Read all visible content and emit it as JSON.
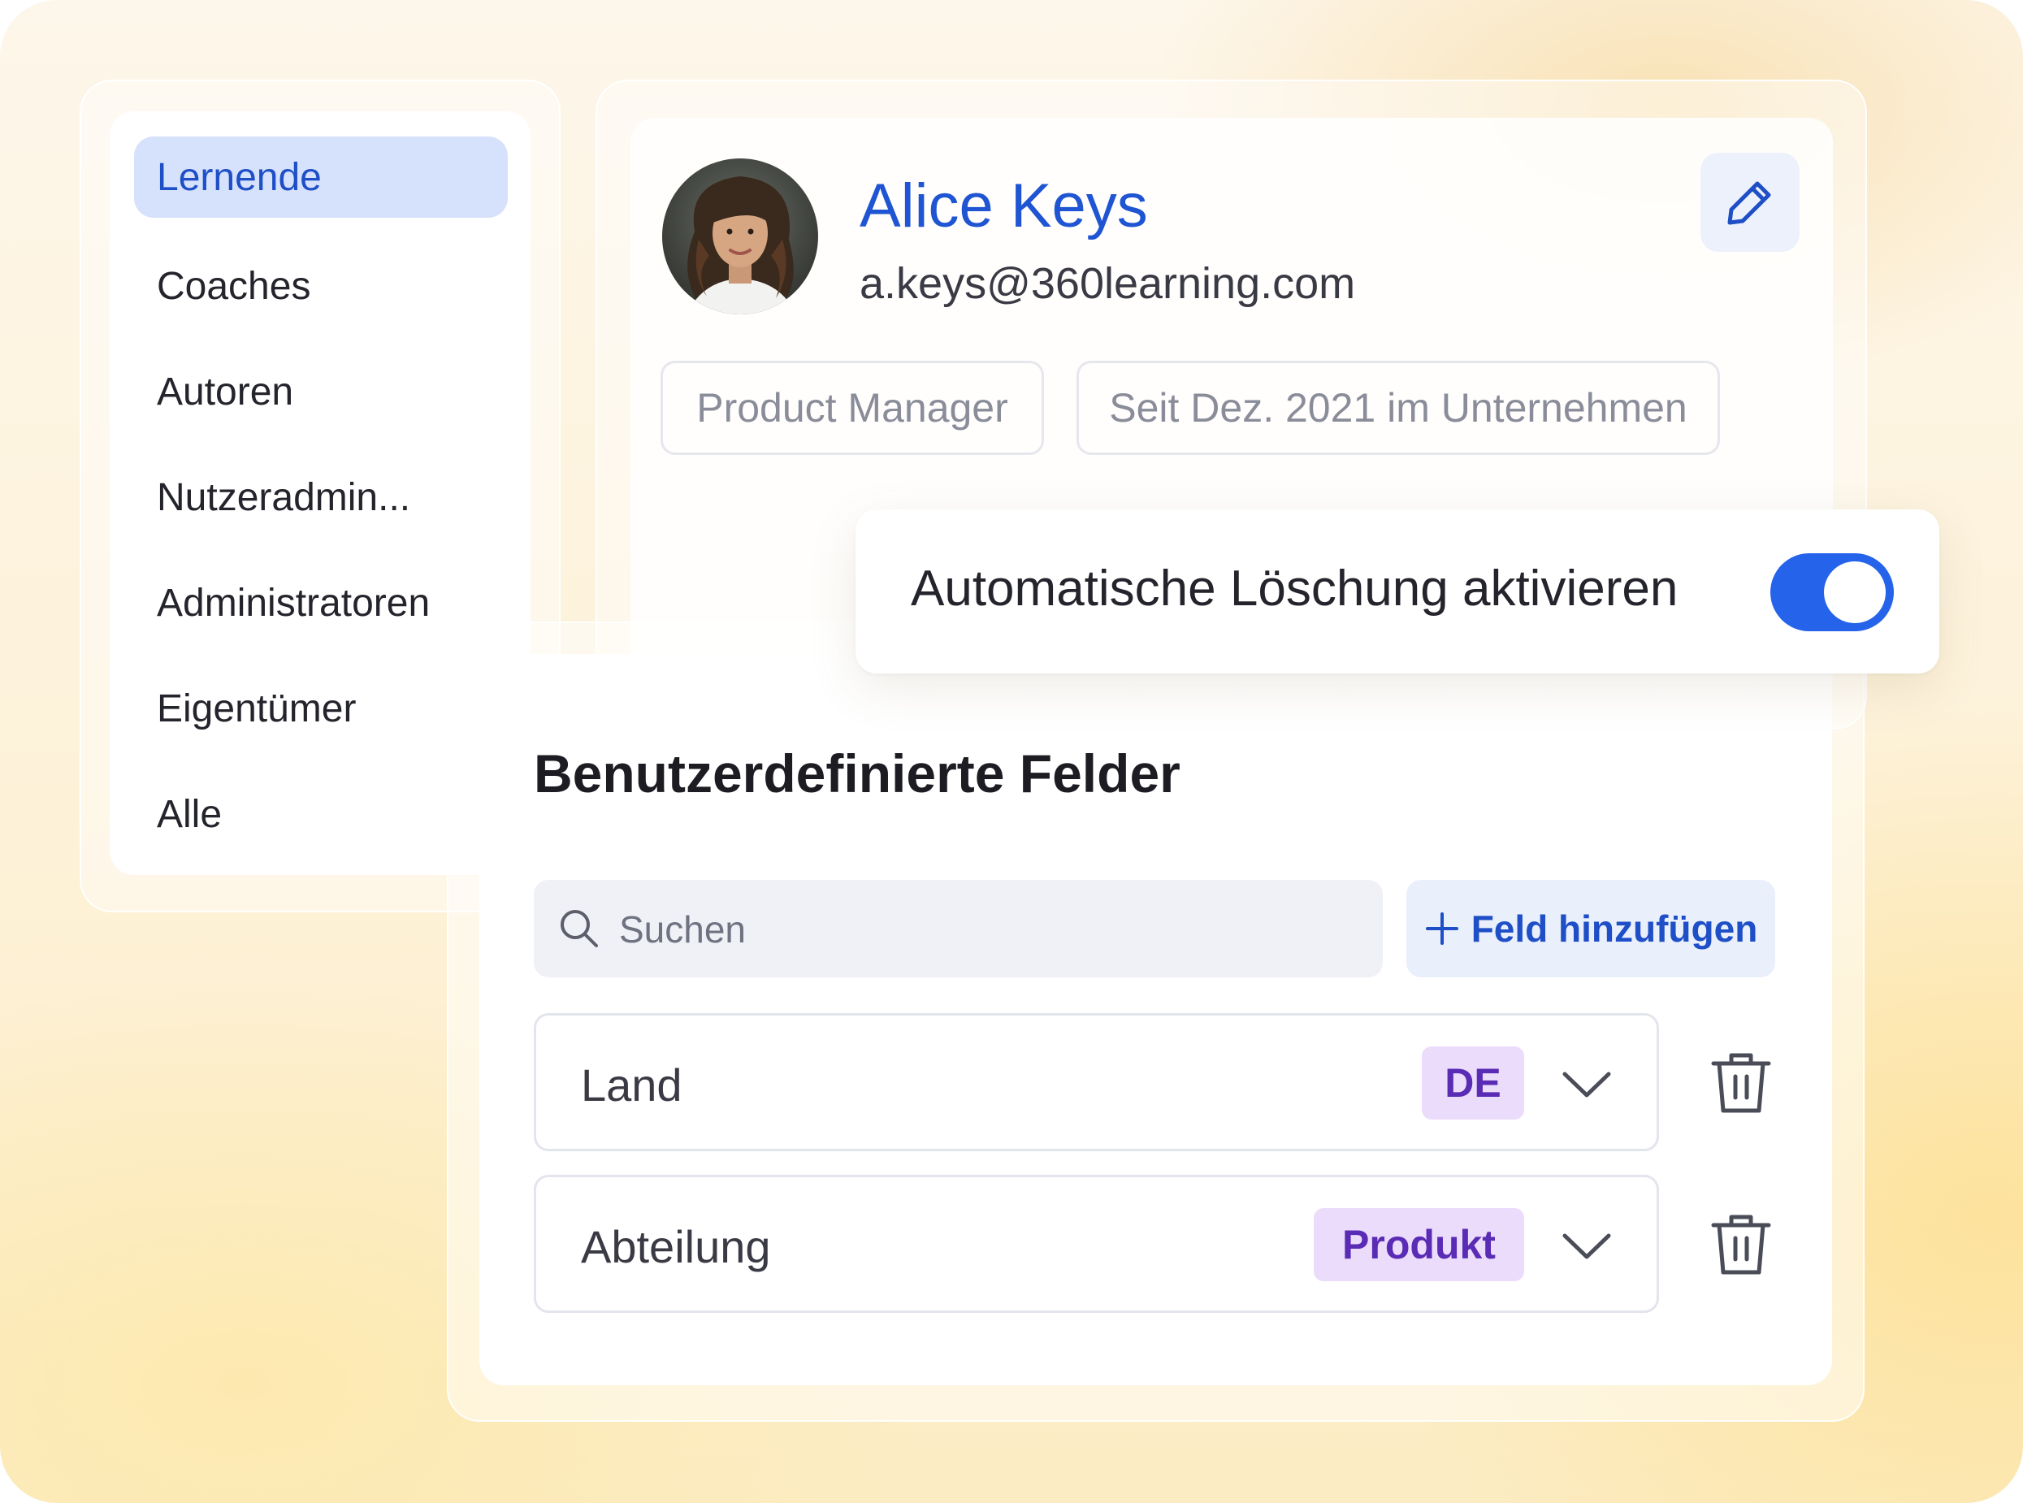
{
  "sidebar": {
    "items": [
      {
        "label": "Lernende",
        "active": true
      },
      {
        "label": "Coaches"
      },
      {
        "label": "Autoren"
      },
      {
        "label": "Nutzeradmin..."
      },
      {
        "label": "Administratoren"
      },
      {
        "label": "Eigentümer"
      },
      {
        "label": "Alle"
      }
    ]
  },
  "profile": {
    "name": "Alice Keys",
    "email": "a.keys@360learning.com",
    "avatar_icon": "avatar-photo",
    "edit_icon": "pencil-icon",
    "chips": [
      "Product Manager",
      "Seit Dez. 2021 im Unternehmen"
    ]
  },
  "auto_delete": {
    "label": "Automatische Löschung aktivieren",
    "enabled": true
  },
  "custom_fields": {
    "title": "Benutzerdefinierte Felder",
    "search": {
      "placeholder": "Suchen"
    },
    "add_button": {
      "icon": "plus-icon",
      "label": "Feld hinzufügen"
    },
    "rows": [
      {
        "label": "Land",
        "value": "DE"
      },
      {
        "label": "Abteilung",
        "value": "Produkt"
      }
    ]
  },
  "colors": {
    "accent": "#2563eb",
    "active_nav_bg": "#d6e1fb",
    "tag_bg": "#ebdcfb",
    "tag_text": "#5a2bb5"
  }
}
